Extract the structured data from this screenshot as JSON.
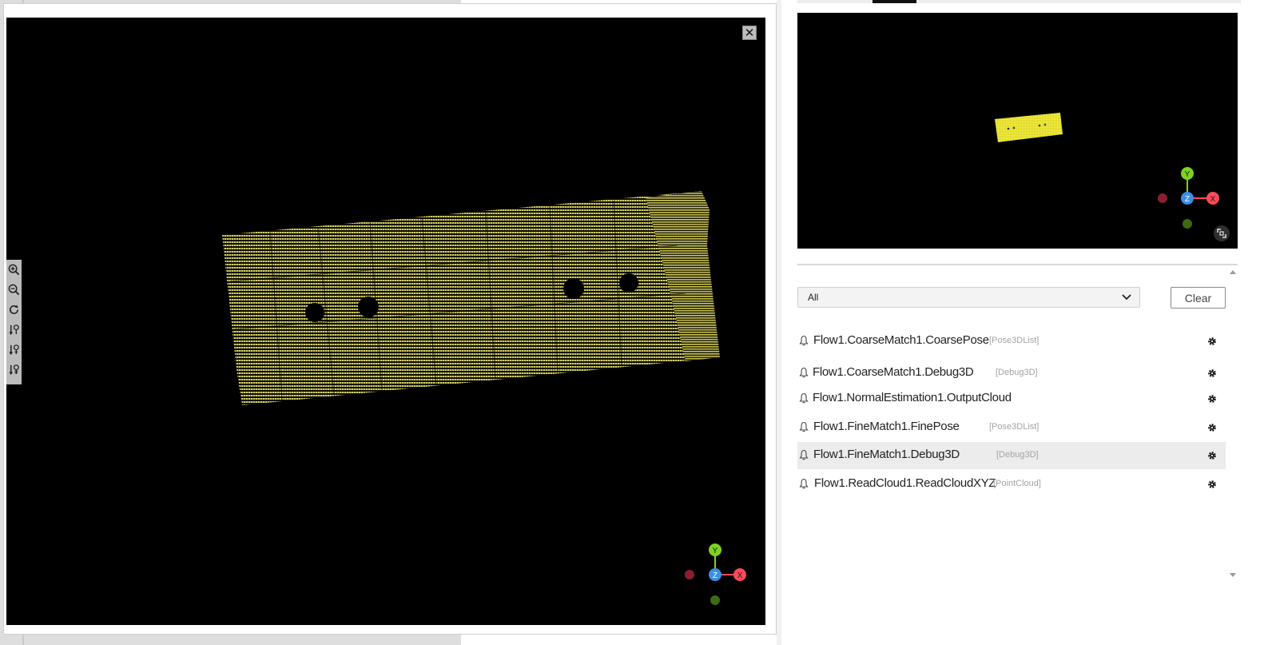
{
  "main_view": {
    "close_label": "✕",
    "axes": {
      "y": "Y",
      "z": "Z",
      "x": "X"
    }
  },
  "toolbar": {
    "items": [
      {
        "name": "zoom-in-icon"
      },
      {
        "name": "zoom-out-icon"
      },
      {
        "name": "reset-view-icon"
      },
      {
        "name": "view-preset-1-icon"
      },
      {
        "name": "view-preset-2-icon"
      },
      {
        "name": "view-preset-3-icon"
      }
    ]
  },
  "preview_view": {
    "axes": {
      "y": "Y",
      "z": "Z",
      "x": "X"
    }
  },
  "filter": {
    "selected": "All"
  },
  "clear_label": "Clear",
  "outputs": [
    {
      "name": "Flow1.CoarseMatch1.CoarsePose",
      "type": "[Pose3DList]",
      "selected": false
    },
    {
      "name": "Flow1.CoarseMatch1.Debug3D",
      "type": "[Debug3D]",
      "selected": false
    },
    {
      "name": "Flow1.NormalEstimation1.OutputCloud",
      "type": "",
      "selected": false
    },
    {
      "name": "Flow1.FineMatch1.FinePose",
      "type": "[Pose3DList]",
      "selected": false
    },
    {
      "name": "Flow1.FineMatch1.Debug3D",
      "type": "[Debug3D]",
      "selected": true
    },
    {
      "name": "Flow1.ReadCloud1.ReadCloudXYZ",
      "type": "[PointCloud]",
      "selected": false
    }
  ],
  "colors": {
    "cloud": "#d6d061",
    "preview_cloud": "#f1ec3c",
    "axis_x": "#ff4a5a",
    "axis_y": "#7ed321",
    "axis_z": "#3b8ee8"
  }
}
